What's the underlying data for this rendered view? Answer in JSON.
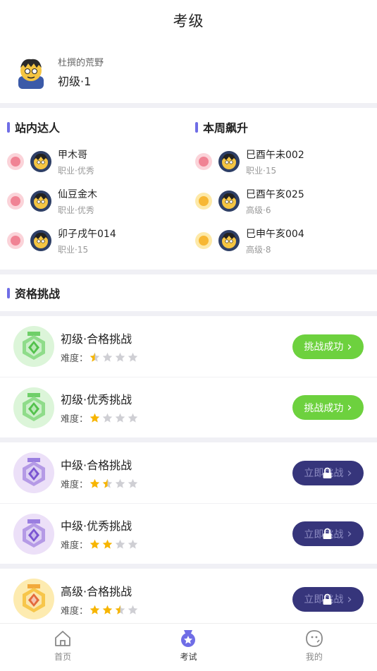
{
  "header": {
    "title": "考级"
  },
  "profile": {
    "name": "杜撰的荒野",
    "level": "初级·1"
  },
  "experts": {
    "title": "站内达人",
    "items": [
      {
        "name": "甲木哥",
        "level": "职业·优秀",
        "medal": "pink"
      },
      {
        "name": "仙豆金木",
        "level": "职业·优秀",
        "medal": "pink"
      },
      {
        "name": "卯子戌午014",
        "level": "职业·15",
        "medal": "pink"
      }
    ]
  },
  "rising": {
    "title": "本周飙升",
    "items": [
      {
        "name": "巳酉午未002",
        "level": "职业·15",
        "medal": "pink"
      },
      {
        "name": "巳酉午亥025",
        "level": "高级·6",
        "medal": "gold"
      },
      {
        "name": "巳申午亥004",
        "level": "高级·8",
        "medal": "gold"
      }
    ]
  },
  "challenge": {
    "title": "资格挑战",
    "difficulty_label": "难度：",
    "items": [
      {
        "title": "初级·合格挑战",
        "stars": 0.5,
        "button": "挑战成功",
        "status": "success",
        "badge": "green"
      },
      {
        "title": "初级·优秀挑战",
        "stars": 1,
        "button": "挑战成功",
        "status": "success",
        "badge": "green"
      },
      {
        "title": "中级·合格挑战",
        "stars": 1.5,
        "button": "立即挑战",
        "status": "locked",
        "badge": "purple"
      },
      {
        "title": "中级·优秀挑战",
        "stars": 2,
        "button": "立即挑战",
        "status": "locked",
        "badge": "purple"
      },
      {
        "title": "高级·合格挑战",
        "stars": 2.5,
        "button": "立即挑战",
        "status": "locked",
        "badge": "gold"
      }
    ]
  },
  "tabs": [
    {
      "label": "首页",
      "icon": "home-icon"
    },
    {
      "label": "考试",
      "icon": "medal-icon",
      "active": true
    },
    {
      "label": "我的",
      "icon": "face-icon"
    }
  ],
  "colors": {
    "accent": "#6f6de6",
    "success": "#6dd13e",
    "locked": "#36357b",
    "star": "#f7b500"
  }
}
